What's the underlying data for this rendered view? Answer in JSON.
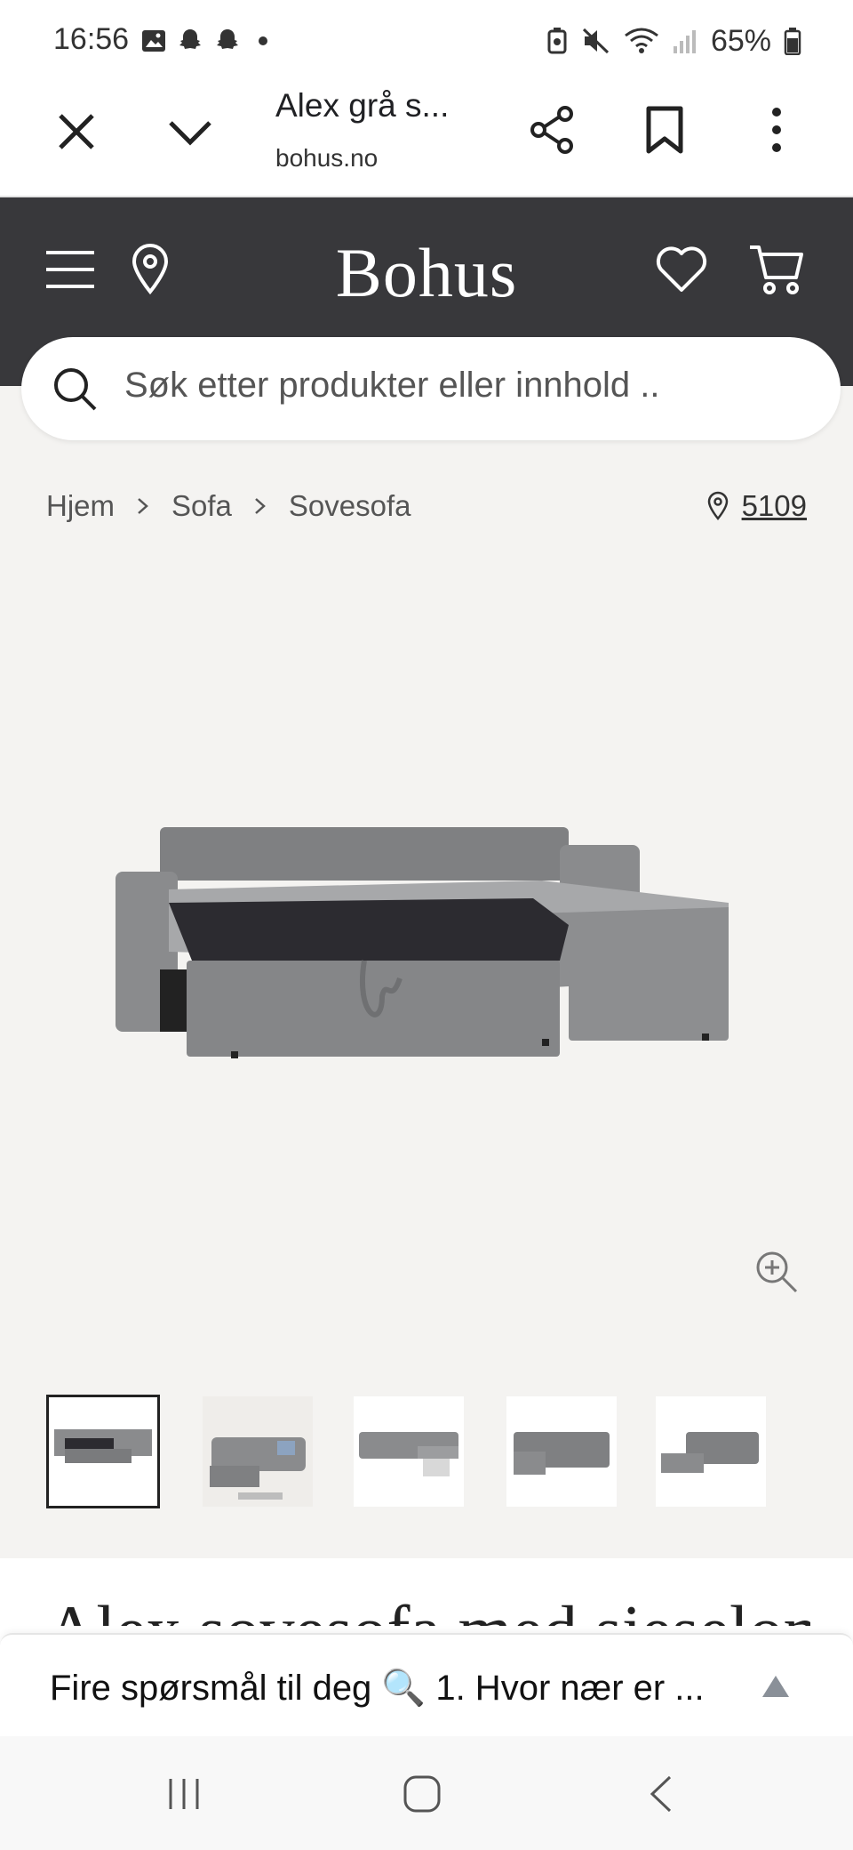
{
  "status_bar": {
    "time": "16:56",
    "battery": "65%"
  },
  "browser": {
    "title": "Alex grå s...",
    "url": "bohus.no"
  },
  "header": {
    "logo": "Bohus"
  },
  "search": {
    "placeholder": "Søk etter produkter eller innhold .."
  },
  "breadcrumb": {
    "items": [
      "Hjem",
      "Sofa",
      "Sovesofa"
    ]
  },
  "store": {
    "id": "5109"
  },
  "product": {
    "image_name": "grey sleeper sofa with chaise",
    "thumbnails": [
      "thumbnail-1",
      "thumbnail-2",
      "thumbnail-3",
      "thumbnail-4",
      "thumbnail-5"
    ],
    "heading_peek": "Alex sovesofa med sjeselong"
  },
  "chat": {
    "text": "Fire spørsmål til deg 🔍 1. Hvor nær er ..."
  },
  "colors": {
    "header_bg": "#38383b",
    "page_bg": "#f4f3f1",
    "accent": "#ffffff"
  }
}
